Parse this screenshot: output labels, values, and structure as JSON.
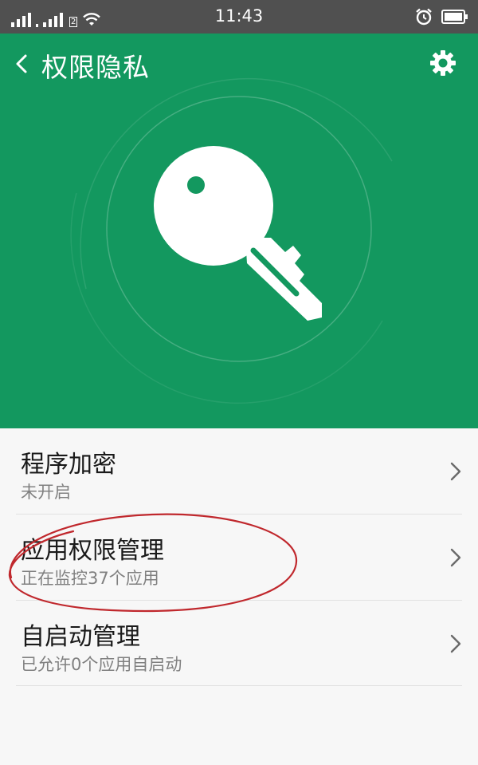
{
  "status_bar": {
    "time": "11:43",
    "sim_label": "2"
  },
  "header": {
    "title": "权限隐私",
    "back_icon": "chevron-left-icon",
    "settings_icon": "gear-icon",
    "hero_icon": "key-icon",
    "background_color": "#13985f"
  },
  "items": [
    {
      "title": "程序加密",
      "subtitle": "未开启"
    },
    {
      "title": "应用权限管理",
      "subtitle": "正在监控37个应用"
    },
    {
      "title": "自启动管理",
      "subtitle": "已允许0个应用自启动"
    }
  ],
  "annotation": {
    "shape": "ellipse",
    "color": "#c0282d",
    "target": "应用权限管理"
  }
}
